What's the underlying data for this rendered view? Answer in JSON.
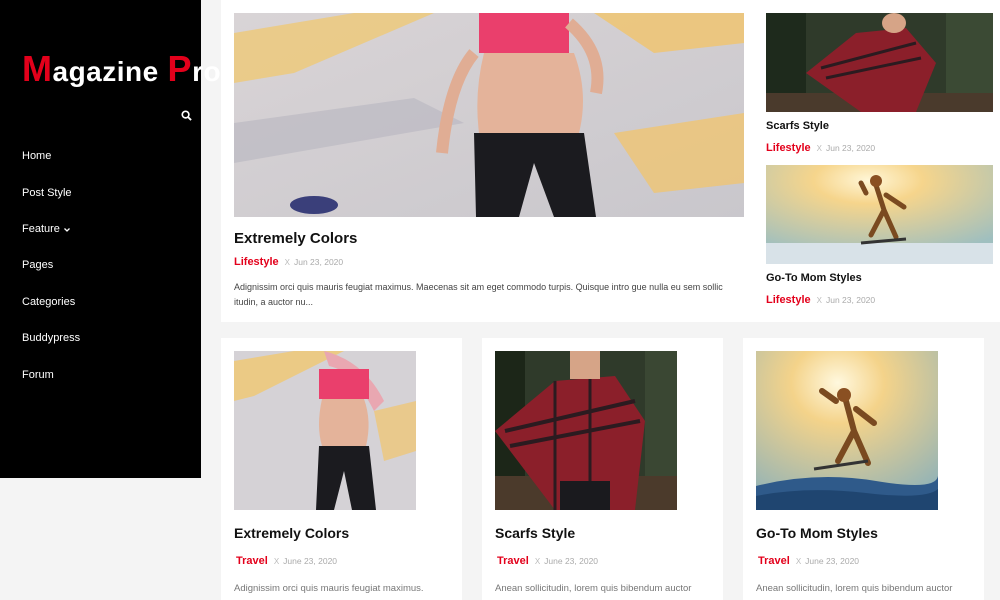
{
  "site": {
    "logo_first_initial": "M",
    "logo_first_rest": "agazine",
    "logo_second_initial": "P",
    "logo_second_rest": "ro",
    "brand_color": "#e3001b"
  },
  "sidebar": {
    "search_icon": "search-icon",
    "items": [
      {
        "label": "Home"
      },
      {
        "label": "Post Style"
      },
      {
        "label": "Feature",
        "has_dropdown": true
      },
      {
        "label": "Pages"
      },
      {
        "label": "Categories"
      },
      {
        "label": "Buddypress"
      },
      {
        "label": "Forum"
      }
    ]
  },
  "featured": {
    "main": {
      "title": "Extremely Colors",
      "category": "Lifestyle",
      "separator": "X",
      "date": "Jun 23, 2020",
      "excerpt": "Adignissim orci quis mauris feugiat maximus. Maecenas sit am eget commodo turpis. Quisque intro gue nulla eu sem sollic itudin, a auctor nu..."
    },
    "side": [
      {
        "title": "Scarfs Style",
        "category": "Lifestyle",
        "separator": "X",
        "date": "Jun 23, 2020"
      },
      {
        "title": "Go-To Mom Styles",
        "category": "Lifestyle",
        "separator": "X",
        "date": "Jun 23, 2020"
      }
    ]
  },
  "cards": [
    {
      "title": "Extremely Colors",
      "category": "Travel",
      "separator": "X",
      "date": "June 23, 2020",
      "excerpt": "Adignissim orci quis mauris feugiat maximus."
    },
    {
      "title": "Scarfs Style",
      "category": "Travel",
      "separator": "X",
      "date": "June 23, 2020",
      "excerpt": "Anean sollicitudin, lorem quis bibendum auctor"
    },
    {
      "title": "Go-To Mom Styles",
      "category": "Travel",
      "separator": "X",
      "date": "June 23, 2020",
      "excerpt": "Anean sollicitudin, lorem quis bibendum auctor"
    }
  ]
}
